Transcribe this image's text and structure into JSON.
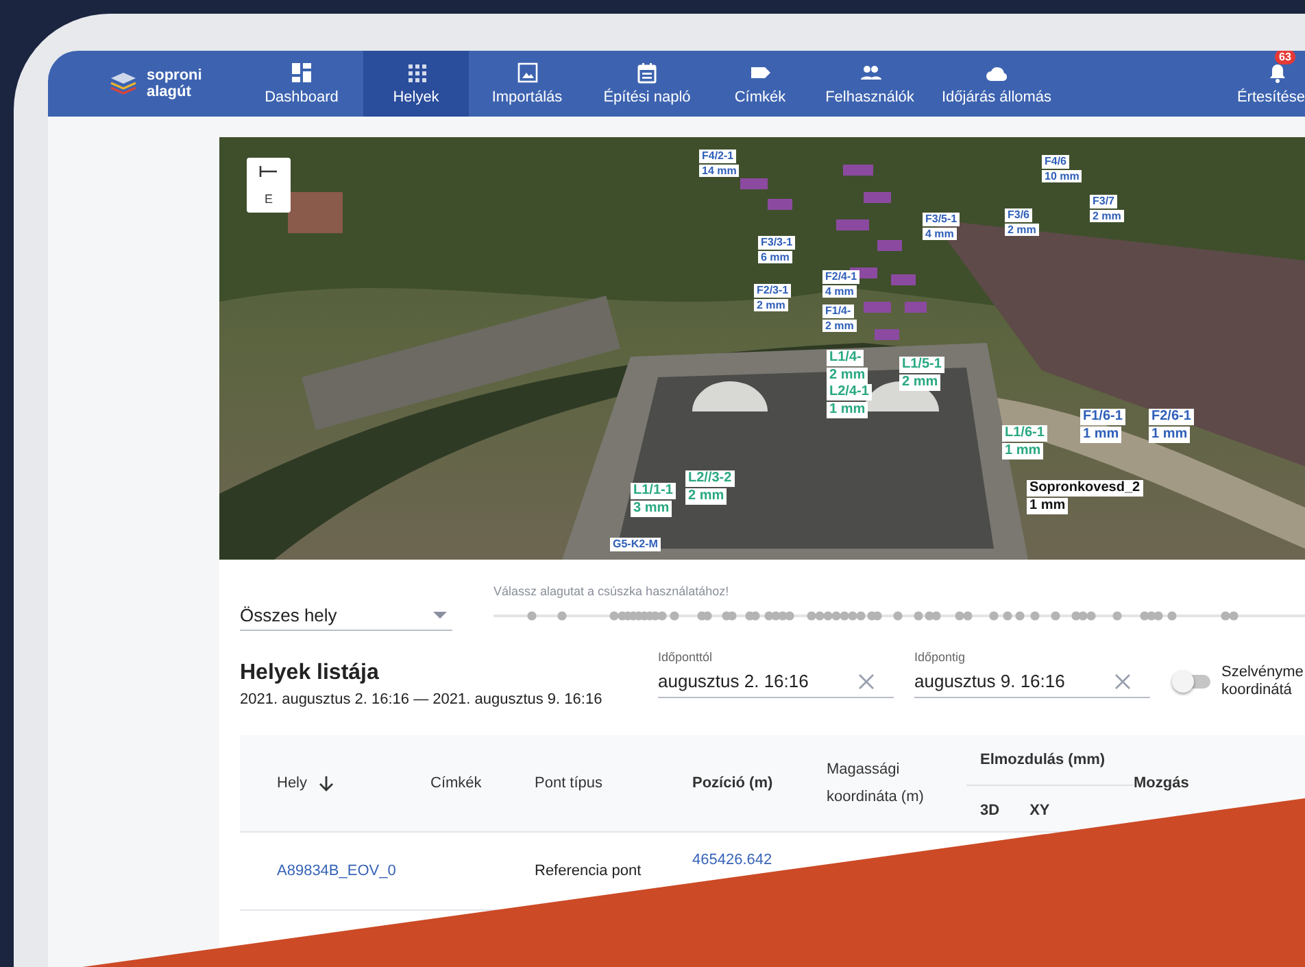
{
  "logo": {
    "lines": [
      "soproni",
      "alagút"
    ]
  },
  "nav": [
    {
      "label": "Dashboard",
      "selected": false
    },
    {
      "label": "Helyek",
      "selected": true
    },
    {
      "label": "Importálás",
      "selected": false
    },
    {
      "label": "Építési napló",
      "selected": false
    },
    {
      "label": "Címkék",
      "selected": false
    },
    {
      "label": "Felhasználók",
      "selected": false
    },
    {
      "label": "Időjárás állomás",
      "selected": false
    }
  ],
  "notifications": {
    "label": "Értesítése",
    "badge": "63"
  },
  "viewer": {
    "compass": "E",
    "labels": [
      {
        "name": "F4/2-1",
        "value": "14 mm",
        "color": "#2f5fb8"
      },
      {
        "name": "F4/6",
        "value": "10 mm",
        "color": "#2f5fb8"
      },
      {
        "name": "F3/7",
        "value": "2 mm",
        "color": "#2f5fb8"
      },
      {
        "name": "F3/5-1",
        "value": "4 mm",
        "color": "#2f5fb8"
      },
      {
        "name": "F3/6",
        "value": "2 mm",
        "color": "#2f5fb8"
      },
      {
        "name": "F3/3-1",
        "value": "6 mm",
        "color": "#2f5fb8"
      },
      {
        "name": "F2/4-1",
        "value": "4 mm",
        "color": "#2f5fb8"
      },
      {
        "name": "F2/3-1",
        "value": "2 mm",
        "color": "#2f5fb8"
      },
      {
        "name": "F1/4-",
        "value": "2 mm",
        "color": "#2f5fb8"
      },
      {
        "name": "L1/4-",
        "value": "2 mm",
        "color": "#2aa882"
      },
      {
        "name": "L1/5-1",
        "value": "2 mm",
        "color": "#2aa882"
      },
      {
        "name": "L2/4-1",
        "value": "1 mm",
        "color": "#2aa882"
      },
      {
        "name": "F1/6-1",
        "value": "1 mm",
        "color": "#2f5fb8"
      },
      {
        "name": "F2/6-1",
        "value": "1 mm",
        "color": "#2f5fb8"
      },
      {
        "name": "L1/6-1",
        "value": "1 mm",
        "color": "#2aa882"
      },
      {
        "name": "Sopronkovesd_2",
        "value": "1 mm",
        "color": "#111111"
      },
      {
        "name": "L2//3-2",
        "value": "2 mm",
        "color": "#2aa882"
      },
      {
        "name": "L1/1-1",
        "value": "3 mm",
        "color": "#2aa882"
      },
      {
        "name": "G5-K2-M",
        "color": "#2f5fb8"
      }
    ]
  },
  "filter": {
    "value": "Összes hely"
  },
  "slider": {
    "hint": "Válassz alagutat a csúszka használatához!",
    "disabled": true
  },
  "list": {
    "title": "Helyek listája",
    "range": "2021. augusztus 2. 16:16 — 2021. augusztus 9. 16:16"
  },
  "date_fields": [
    {
      "label": "Időponttól",
      "value": "augusztus 2. 16:16"
    },
    {
      "label": "Időpontig",
      "value": "augusztus 9. 16:16"
    }
  ],
  "toggle": {
    "label_lines": [
      "Szelvényme",
      "koordinátá"
    ],
    "on": false
  },
  "table": {
    "columns": [
      {
        "label": "Hely"
      },
      {
        "label": "Címkék"
      },
      {
        "label": "Pont típus"
      },
      {
        "label": "Pozíció (m)"
      },
      {
        "label": "Magassági koordináta (m)"
      },
      {
        "label": "Elmozdulás (mm)",
        "subcolumns": [
          "3D",
          "XY"
        ]
      },
      {
        "label": "Mozgás"
      }
    ],
    "rows": [
      {
        "hely": "A89834B_EOV_0",
        "pont_tipus": "Referencia pont",
        "pozicio": "465426.642"
      }
    ]
  }
}
